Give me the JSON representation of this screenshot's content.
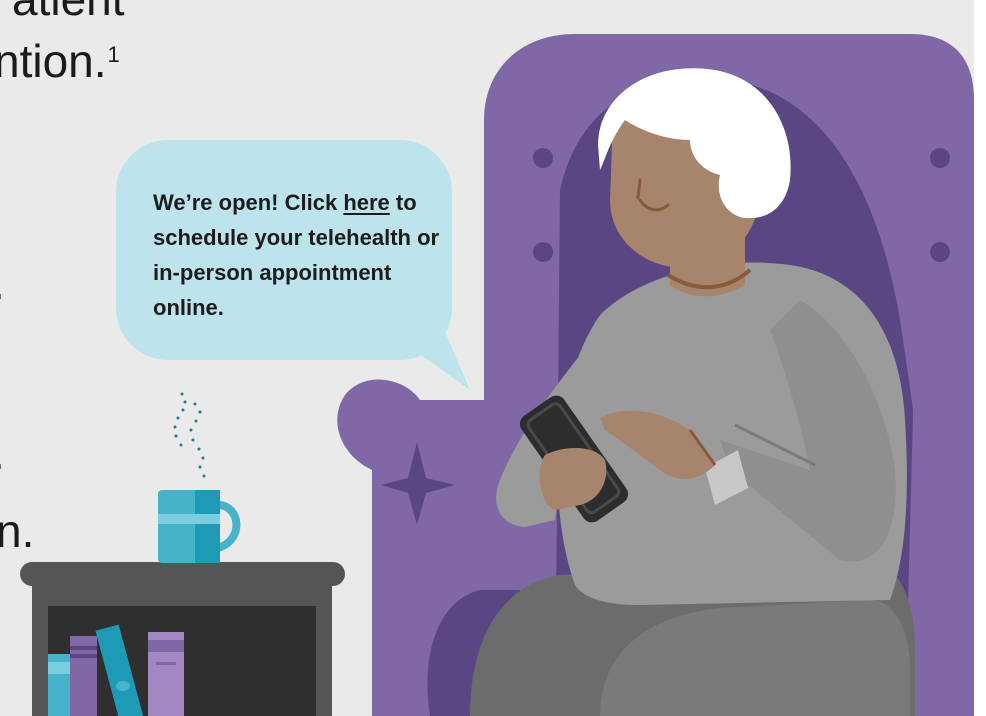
{
  "text_fragments": {
    "line_top": "atient",
    "line_second": "ntion.",
    "footnote": "1",
    "fragment_a": ".",
    "fragment_b": ".",
    "fragment_c": "n."
  },
  "speech_bubble": {
    "text_before": "We’re open! Click ",
    "link_text": "here",
    "text_after": " to schedule your telehealth or in-person appointment online."
  },
  "colors": {
    "background": "#eaeaea",
    "chair_purple": "#8068a6",
    "chair_shadow": "#5a4683",
    "bubble": "#bde3ec",
    "skin": "#a7846c",
    "sweater": "#9b9b9b",
    "pants": "#6c6c6c",
    "hair": "#ffffff",
    "phone": "#2d2d2d",
    "mug": "#46b3cb",
    "table": "#555555"
  }
}
